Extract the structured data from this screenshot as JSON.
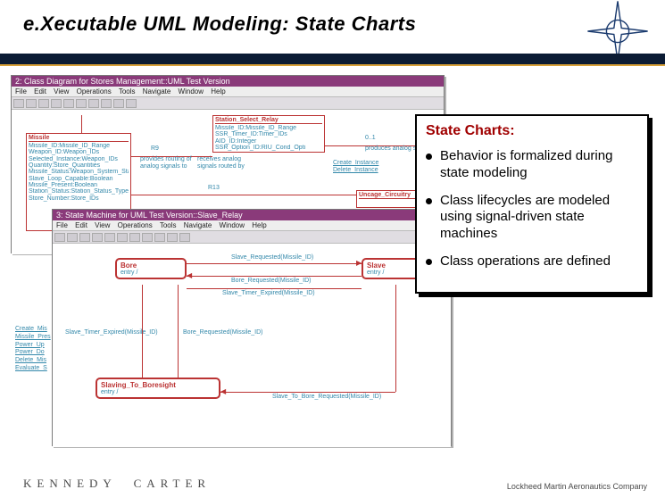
{
  "header": {
    "title": "e.Xecutable UML Modeling: State Charts"
  },
  "callout": {
    "heading": "State Charts:",
    "items": [
      "Behavior is formalized during state modeling",
      "Class lifecycles are modeled using signal-driven state machines",
      "Class operations are defined"
    ]
  },
  "win1": {
    "title": "2: Class Diagram for Stores Management::UML Test Version",
    "menu": [
      "File",
      "Edit",
      "View",
      "Operations",
      "Tools",
      "Navigate",
      "Window",
      "Help"
    ],
    "boxes": {
      "missile": {
        "name": "Missile",
        "attrs": [
          "Missile_ID:Missile_ID_Range",
          "Weapon_ID:Weapon_IDs",
          "Selected_Instance:Weapon_IDs",
          "Quantity:Store_Quantities",
          "Missile_Status:Weapon_System_Status",
          "Slave_Loop_Capable:Boolean",
          "Missile_Present:Boolean",
          "Station_Status:Station_Status_Type",
          "Store_Number:Store_IDs"
        ]
      },
      "relay": {
        "name": "Station_Select_Relay",
        "attrs": [
          "Missile_ID:Missile_ID_Range",
          "SSR_Timer_ID:Timer_IDs",
          "AID_ID:Integer",
          "SSR_Option_ID:RIU_Cond_Opti"
        ]
      },
      "uncage": {
        "name": "Uncage_Circuitry"
      }
    },
    "rels": {
      "r9_left": "provides routing of",
      "r9_right": "receives analog",
      "r9b_left": "analog signals to",
      "r9b_right": "signals routed by",
      "r13": "R13",
      "r9": "R9",
      "mult": "0..1",
      "prod": "produces analog signals routed by",
      "ci": "Create_Instance",
      "di": "Delete_Instance"
    },
    "links": [
      "Create_Mis",
      "Missile_Pres",
      "Power_Up",
      "Power_Do",
      "Delete_Mis",
      "Evaluate_S"
    ]
  },
  "win2": {
    "title": "3: State Machine for UML Test Version::Slave_Relay",
    "menu": [
      "File",
      "Edit",
      "View",
      "Operations",
      "Tools",
      "Navigate",
      "Window",
      "Help"
    ],
    "states": {
      "bore": {
        "name": "Bore",
        "sub": "entry /"
      },
      "slave": {
        "name": "Slave",
        "sub": "entry /"
      },
      "slaving": {
        "name": "Slaving_To_Boresight",
        "sub": "entry /"
      }
    },
    "trans": {
      "t1": "Slave_Requested(Missile_ID)",
      "t2": "Bore_Requested(Missile_ID)",
      "t3": "Slave_Timer_Expired(Missile_ID)",
      "t4": "Slave_Timer_Expired(Missile_ID)",
      "t5": "Bore_Requested(Missile_ID)",
      "t6": "Slave_To_Bore_Requested(Missile_ID)"
    }
  },
  "footer": {
    "left1": "KENNEDY",
    "left2": "CARTER",
    "right": "Lockheed Martin Aeronautics Company"
  }
}
